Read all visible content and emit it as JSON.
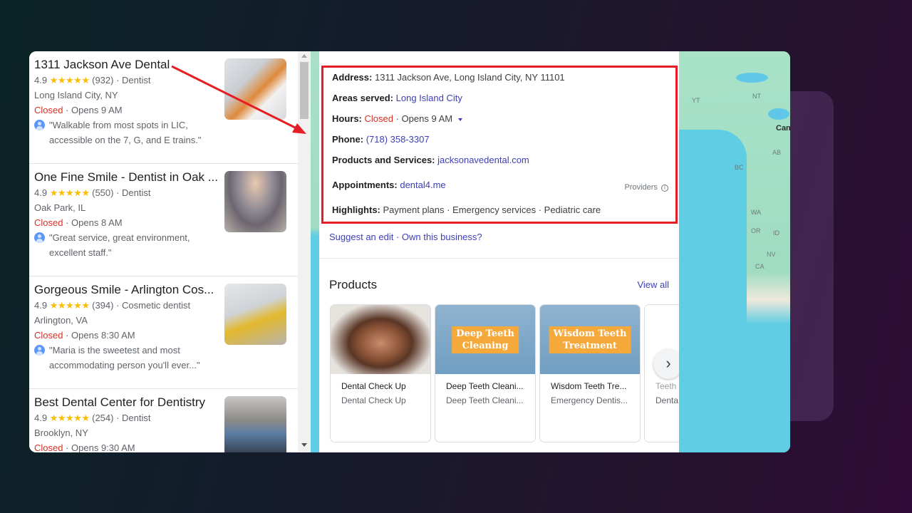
{
  "results": [
    {
      "name": "1311 Jackson Ave Dental",
      "rating": "4.9",
      "stars": "★★★★★",
      "reviews": "(932)",
      "category": "Dentist",
      "location": "Long Island City, NY",
      "status": "Closed",
      "opens": "Opens 9 AM",
      "review": "\"Walkable from most spots in LIC, accessible on the 7, G, and E trains.\""
    },
    {
      "name": "One Fine Smile - Dentist in Oak ...",
      "rating": "4.9",
      "stars": "★★★★★",
      "reviews": "(550)",
      "category": "Dentist",
      "location": "Oak Park, IL",
      "status": "Closed",
      "opens": "Opens 8 AM",
      "review": "\"Great service, great environment, excellent staff.\""
    },
    {
      "name": "Gorgeous Smile - Arlington Cos...",
      "rating": "4.9",
      "stars": "★★★★★",
      "reviews": "(394)",
      "category": "Cosmetic dentist",
      "location": "Arlington, VA",
      "status": "Closed",
      "opens": "Opens 8:30 AM",
      "review": "\"Maria is the sweetest and most accommodating person you'll ever...\""
    },
    {
      "name": "Best Dental Center for Dentistry",
      "rating": "4.9",
      "stars": "★★★★★",
      "reviews": "(254)",
      "category": "Dentist",
      "location": "Brooklyn, NY",
      "status": "Closed",
      "opens": "Opens 9:30 AM",
      "review": ""
    }
  ],
  "details": {
    "address_label": "Address:",
    "address": "1311 Jackson Ave, Long Island City, NY 11101",
    "areas_label": "Areas served:",
    "areas": "Long Island City",
    "hours_label": "Hours:",
    "hours_status": "Closed",
    "hours_opens": "· Opens 9 AM",
    "phone_label": "Phone:",
    "phone": "(718) 358-3307",
    "products_label": "Products and Services:",
    "products_link": "jacksonavedental.com",
    "appointments_label": "Appointments:",
    "appointments_link": "dental4.me",
    "providers": "Providers",
    "info_glyph": "i",
    "highlights_label": "Highlights:",
    "highlights": "Payment plans · Emergency services · Pediatric care",
    "suggest_edit": "Suggest an edit",
    "separator": " · ",
    "own_business": "Own this business?"
  },
  "products": {
    "title": "Products",
    "view_all": "View all",
    "items": [
      {
        "name": "Dental Check Up",
        "sub": "Dental Check Up",
        "badge": ""
      },
      {
        "name": "Deep Teeth Cleani...",
        "sub": "Deep Teeth Cleani...",
        "badge": "Deep Teeth\nCleaning"
      },
      {
        "name": "Wisdom Teeth Tre...",
        "sub": "Emergency Dentis...",
        "badge": "Wisdom Teeth\nTreatment"
      },
      {
        "name": "Teeth",
        "sub": "Denta",
        "badge": ""
      }
    ],
    "next_glyph": "›"
  },
  "map": {
    "labels": [
      "YT",
      "NT",
      "Can",
      "AB",
      "BC",
      "WA",
      "OR",
      "ID",
      "NV",
      "CA"
    ]
  },
  "annotation": {
    "color": "#e41e26"
  }
}
